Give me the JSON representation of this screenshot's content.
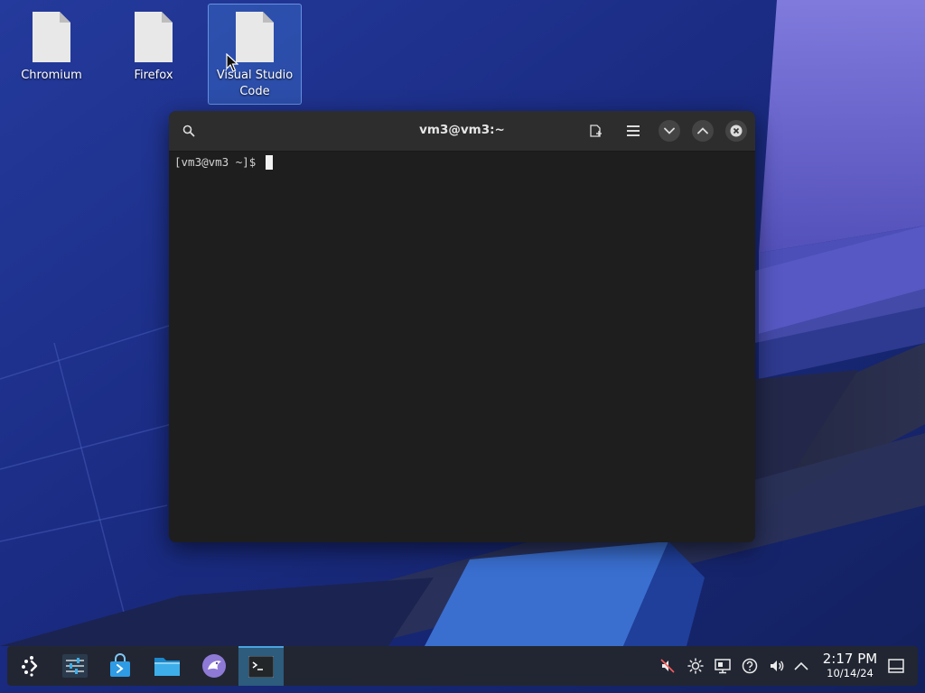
{
  "desktop": {
    "icons": [
      {
        "label": "Chromium"
      },
      {
        "label": "Firefox"
      },
      {
        "label": "Visual Studio Code",
        "selected": true
      }
    ]
  },
  "terminal": {
    "title": "vm3@vm3:~",
    "prompt": "[vm3@vm3 ~]$ ",
    "titlebar_buttons": [
      "search-icon",
      "new-tab-icon",
      "menu-icon",
      "minimize-icon",
      "maximize-icon",
      "close-icon"
    ]
  },
  "taskbar": {
    "launcher_items": [
      "application-launcher",
      "system-settings",
      "discover",
      "dolphin-file-manager",
      "kdeconnect",
      "konsole-terminal"
    ],
    "active_item": "konsole-terminal",
    "tray": [
      "microphone-muted-icon",
      "brightness-icon",
      "network-icon",
      "help-icon",
      "volume-icon",
      "show-hidden-icon"
    ],
    "clock": {
      "time": "2:17 PM",
      "date": "10/14/24"
    }
  },
  "colors": {
    "panel": "#22262f",
    "terminal_bg": "#1e1e1e",
    "titlebar_bg": "#2d2d2d",
    "accent": "#4aa3df"
  }
}
